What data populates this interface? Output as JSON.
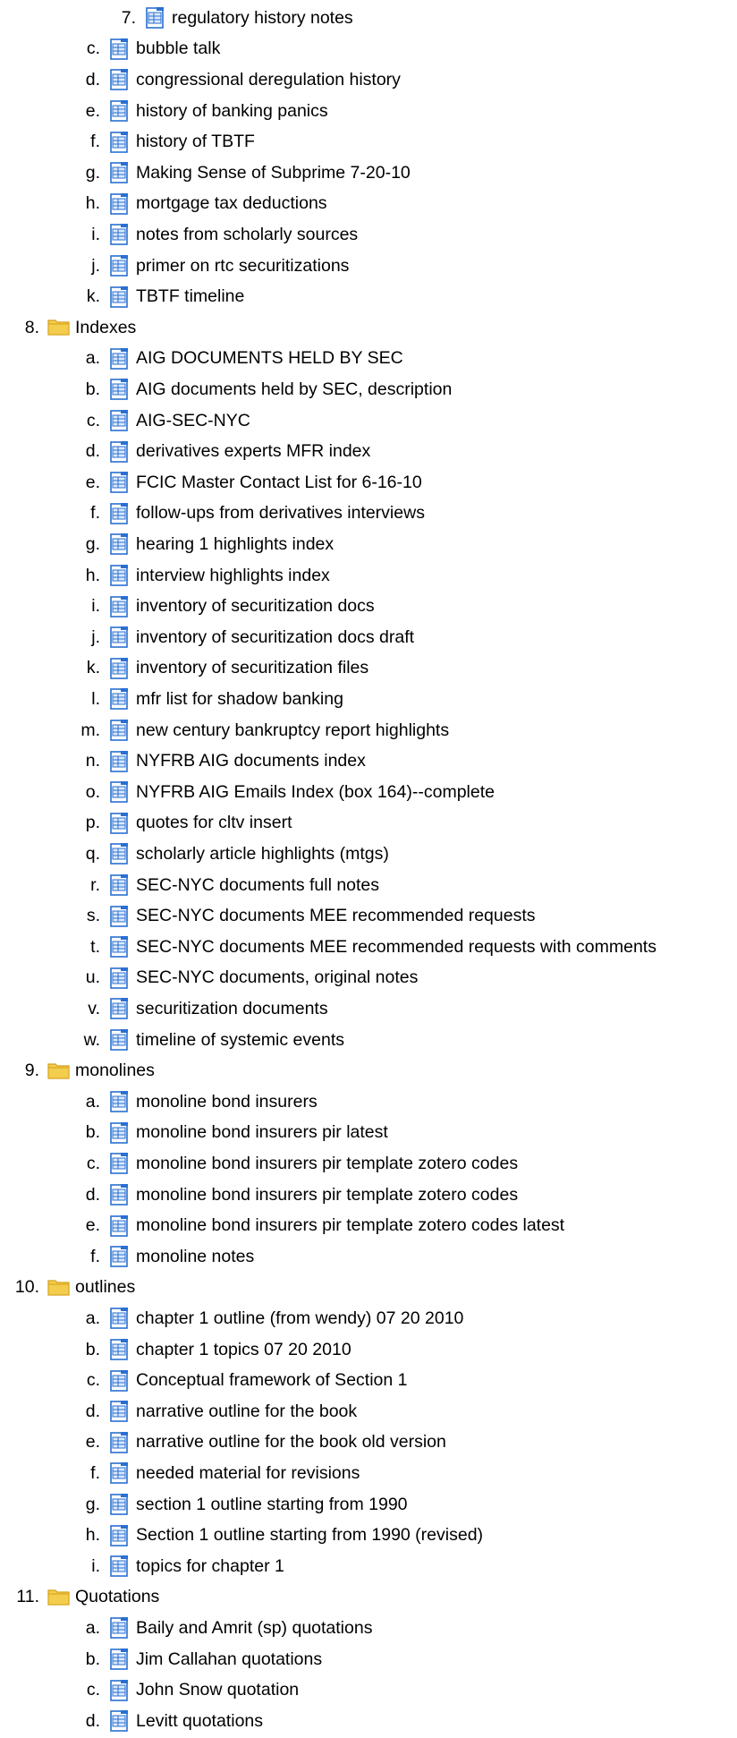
{
  "colors": {
    "folder": "#f3cd4e",
    "folder_edge": "#d4a017",
    "doc_blue": "#2a6fd1",
    "doc_fill": "#dbe8fb"
  },
  "rows": [
    {
      "marker": "7.",
      "icon": "document-icon",
      "label": "regulatory history notes",
      "level": 2
    },
    {
      "marker": "c.",
      "icon": "document-icon",
      "label": "bubble talk",
      "level": 1
    },
    {
      "marker": "d.",
      "icon": "document-icon",
      "label": "congressional deregulation history",
      "level": 1
    },
    {
      "marker": "e.",
      "icon": "document-icon",
      "label": "history of banking panics",
      "level": 1
    },
    {
      "marker": "f.",
      "icon": "document-icon",
      "label": "history of TBTF",
      "level": 1
    },
    {
      "marker": "g.",
      "icon": "document-icon",
      "label": "Making Sense of Subprime 7-20-10",
      "level": 1
    },
    {
      "marker": "h.",
      "icon": "document-icon",
      "label": "mortgage tax deductions",
      "level": 1
    },
    {
      "marker": "i.",
      "icon": "document-icon",
      "label": "notes from scholarly sources",
      "level": 1
    },
    {
      "marker": "j.",
      "icon": "document-icon",
      "label": "primer on rtc securitizations",
      "level": 1
    },
    {
      "marker": "k.",
      "icon": "document-icon",
      "label": "TBTF timeline",
      "level": 1
    },
    {
      "marker": "8.",
      "icon": "folder-icon",
      "label": "Indexes",
      "level": 0
    },
    {
      "marker": "a.",
      "icon": "document-icon",
      "label": "AIG DOCUMENTS HELD BY SEC",
      "level": 1
    },
    {
      "marker": "b.",
      "icon": "document-icon",
      "label": "AIG documents held by SEC, description",
      "level": 1
    },
    {
      "marker": "c.",
      "icon": "document-icon",
      "label": "AIG-SEC-NYC",
      "level": 1
    },
    {
      "marker": "d.",
      "icon": "document-icon",
      "label": "derivatives experts MFR index",
      "level": 1
    },
    {
      "marker": "e.",
      "icon": "document-icon",
      "label": "FCIC Master Contact List for 6-16-10",
      "level": 1
    },
    {
      "marker": "f.",
      "icon": "document-icon",
      "label": "follow-ups from derivatives interviews",
      "level": 1
    },
    {
      "marker": "g.",
      "icon": "document-icon",
      "label": "hearing 1 highlights index",
      "level": 1
    },
    {
      "marker": "h.",
      "icon": "document-icon",
      "label": "interview highlights index",
      "level": 1
    },
    {
      "marker": "i.",
      "icon": "document-icon",
      "label": "inventory of securitization docs",
      "level": 1
    },
    {
      "marker": "j.",
      "icon": "document-icon",
      "label": "inventory of securitization docs draft",
      "level": 1
    },
    {
      "marker": "k.",
      "icon": "document-icon",
      "label": "inventory of securitization files",
      "level": 1
    },
    {
      "marker": "l.",
      "icon": "document-icon",
      "label": "mfr list for shadow banking",
      "level": 1
    },
    {
      "marker": "m.",
      "icon": "document-icon",
      "label": "new century bankruptcy report highlights",
      "level": 1
    },
    {
      "marker": "n.",
      "icon": "document-icon",
      "label": "NYFRB AIG documents index",
      "level": 1
    },
    {
      "marker": "o.",
      "icon": "document-icon",
      "label": "NYFRB AIG Emails Index (box 164)--complete",
      "level": 1
    },
    {
      "marker": "p.",
      "icon": "document-icon",
      "label": "quotes for cltv insert",
      "level": 1
    },
    {
      "marker": "q.",
      "icon": "document-icon",
      "label": "scholarly article highlights (mtgs)",
      "level": 1
    },
    {
      "marker": "r.",
      "icon": "document-icon",
      "label": "SEC-NYC documents full notes",
      "level": 1
    },
    {
      "marker": "s.",
      "icon": "document-icon",
      "label": "SEC-NYC documents MEE recommended requests",
      "level": 1
    },
    {
      "marker": "t.",
      "icon": "document-icon",
      "label": "SEC-NYC documents MEE recommended requests with comments",
      "level": 1
    },
    {
      "marker": "u.",
      "icon": "document-icon",
      "label": "SEC-NYC documents, original notes",
      "level": 1
    },
    {
      "marker": "v.",
      "icon": "document-icon",
      "label": "securitization documents",
      "level": 1
    },
    {
      "marker": "w.",
      "icon": "document-icon",
      "label": "timeline of systemic events",
      "level": 1
    },
    {
      "marker": "9.",
      "icon": "folder-icon",
      "label": "monolines",
      "level": 0
    },
    {
      "marker": "a.",
      "icon": "document-icon",
      "label": "monoline bond insurers",
      "level": 1
    },
    {
      "marker": "b.",
      "icon": "document-icon",
      "label": "monoline bond insurers pir latest",
      "level": 1
    },
    {
      "marker": "c.",
      "icon": "document-icon",
      "label": "monoline bond insurers pir template zotero codes",
      "level": 1
    },
    {
      "marker": "d.",
      "icon": "document-icon",
      "label": "monoline bond insurers pir template zotero codes",
      "level": 1
    },
    {
      "marker": "e.",
      "icon": "document-icon",
      "label": "monoline bond insurers pir template zotero codes latest",
      "level": 1
    },
    {
      "marker": "f.",
      "icon": "document-icon",
      "label": "monoline notes",
      "level": 1
    },
    {
      "marker": "10.",
      "icon": "folder-icon",
      "label": "outlines",
      "level": 0
    },
    {
      "marker": "a.",
      "icon": "document-icon",
      "label": "chapter 1 outline (from wendy) 07 20 2010",
      "level": 1
    },
    {
      "marker": "b.",
      "icon": "document-icon",
      "label": "chapter 1 topics 07 20 2010",
      "level": 1
    },
    {
      "marker": "c.",
      "icon": "document-icon",
      "label": "Conceptual framework of Section 1",
      "level": 1
    },
    {
      "marker": "d.",
      "icon": "document-icon",
      "label": "narrative outline for the book",
      "level": 1
    },
    {
      "marker": "e.",
      "icon": "document-icon",
      "label": "narrative outline for the book old version",
      "level": 1
    },
    {
      "marker": "f.",
      "icon": "document-icon",
      "label": "needed material for revisions",
      "level": 1
    },
    {
      "marker": "g.",
      "icon": "document-icon",
      "label": "section 1 outline starting from 1990",
      "level": 1
    },
    {
      "marker": "h.",
      "icon": "document-icon",
      "label": "Section 1 outline starting from 1990 (revised)",
      "level": 1
    },
    {
      "marker": "i.",
      "icon": "document-icon",
      "label": "topics for chapter 1",
      "level": 1
    },
    {
      "marker": "11.",
      "icon": "folder-icon",
      "label": "Quotations",
      "level": 0
    },
    {
      "marker": "a.",
      "icon": "document-icon",
      "label": "Baily and Amrit (sp) quotations",
      "level": 1
    },
    {
      "marker": "b.",
      "icon": "document-icon",
      "label": "Jim Callahan quotations",
      "level": 1
    },
    {
      "marker": "c.",
      "icon": "document-icon",
      "label": "John Snow quotation",
      "level": 1
    },
    {
      "marker": "d.",
      "icon": "document-icon",
      "label": "Levitt quotations",
      "level": 1
    }
  ]
}
